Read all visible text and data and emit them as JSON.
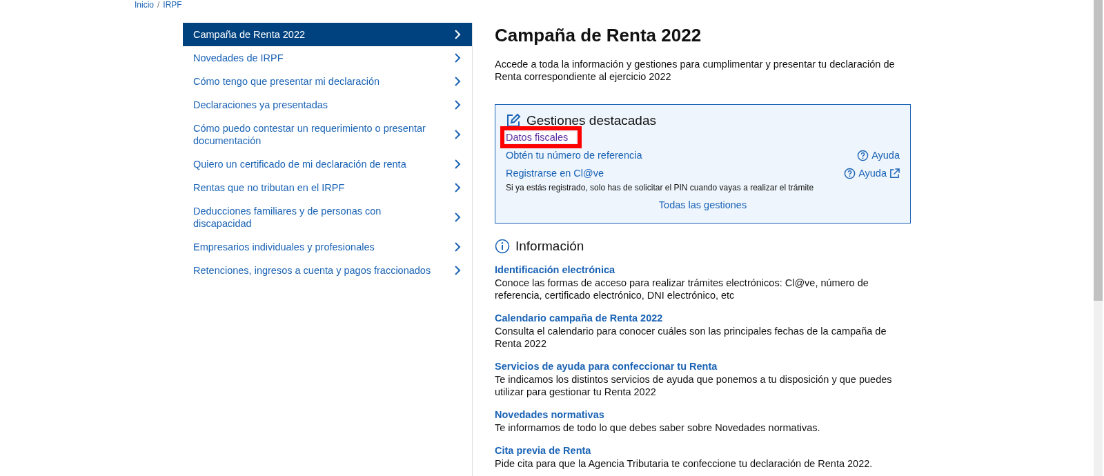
{
  "breadcrumb": {
    "items": [
      "Inicio",
      "IRPF"
    ],
    "separator": "/"
  },
  "sidebar": {
    "items": [
      {
        "label": "Campaña de Renta 2022",
        "selected": true
      },
      {
        "label": "Novedades de IRPF",
        "selected": false
      },
      {
        "label": "Cómo tengo que presentar mi declaración",
        "selected": false
      },
      {
        "label": "Declaraciones ya presentadas",
        "selected": false
      },
      {
        "label": "Cómo puedo contestar un requerimiento o presentar documentación",
        "selected": false
      },
      {
        "label": "Quiero un certificado de mi declaración de renta",
        "selected": false
      },
      {
        "label": "Rentas que no tributan en el IRPF",
        "selected": false
      },
      {
        "label": "Deducciones familiares y de personas con discapacidad",
        "selected": false
      },
      {
        "label": "Empresarios individuales y profesionales",
        "selected": false
      },
      {
        "label": "Retenciones, ingresos a cuenta y pagos fraccionados",
        "selected": false
      }
    ]
  },
  "main": {
    "title": "Campaña de Renta 2022",
    "intro": "Accede a toda la información y gestiones para cumplimentar y presentar tu declaración de Renta correspondiente al ejercicio 2022",
    "featured": {
      "title": "Gestiones destacadas",
      "links": [
        {
          "label": "Datos fiscales",
          "highlighted": true,
          "visited": true
        },
        {
          "label": "Obtén tu número de referencia",
          "highlighted": false,
          "visited": false,
          "help": "Ayuda",
          "external": false
        },
        {
          "label": "Registrarse en Cl@ve",
          "highlighted": false,
          "visited": false,
          "help": "Ayuda",
          "external": true,
          "note": "Si ya estás registrado, solo has de solicitar el PIN cuando vayas a realizar el trámite"
        }
      ],
      "all_link": "Todas las gestiones"
    },
    "info": {
      "title": "Información",
      "items": [
        {
          "title": "Identificación electrónica",
          "text": "Conoce las formas de acceso para realizar trámites electrónicos: Cl@ve, número de referencia, certificado electrónico, DNI electrónico, etc"
        },
        {
          "title": "Calendario campaña de Renta 2022",
          "text": "Consulta el calendario para conocer cuáles son las principales fechas de la campaña de Renta 2022"
        },
        {
          "title": "Servicios de ayuda para confeccionar tu Renta",
          "text": "Te indicamos los distintos servicios de ayuda que ponemos a tu disposición y que puedes utilizar para gestionar tu Renta 2022"
        },
        {
          "title": "Novedades normativas",
          "text": "Te informamos de todo lo que debes saber sobre Novedades normativas."
        },
        {
          "title": "Cita previa de Renta",
          "text": "Pide cita para que la Agencia Tributaria te confeccione tu declaración de Renta 2022."
        }
      ]
    }
  }
}
